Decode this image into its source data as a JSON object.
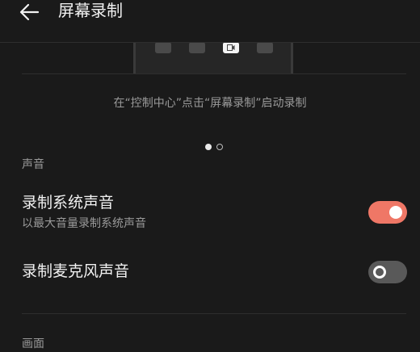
{
  "header": {
    "title": "屏幕录制",
    "back_icon": "arrow-left-icon"
  },
  "preview": {
    "hint": "在“控制中心”点击“屏幕录制”启动录制",
    "active_tile_icon": "screen-record-icon",
    "page_indicator": {
      "total": 2,
      "current": 1
    }
  },
  "sound_section": {
    "label": "声音",
    "items": [
      {
        "title": "录制系统声音",
        "subtitle": "以最大音量录制系统声音",
        "enabled": true
      },
      {
        "title": "录制麦克风声音",
        "enabled": false
      }
    ]
  },
  "picture_section": {
    "label": "画面"
  },
  "colors": {
    "background": "#1a1a1a",
    "toggle_on": "#ef7766",
    "toggle_off": "#595959",
    "secondary_text": "#9a9a9a"
  }
}
